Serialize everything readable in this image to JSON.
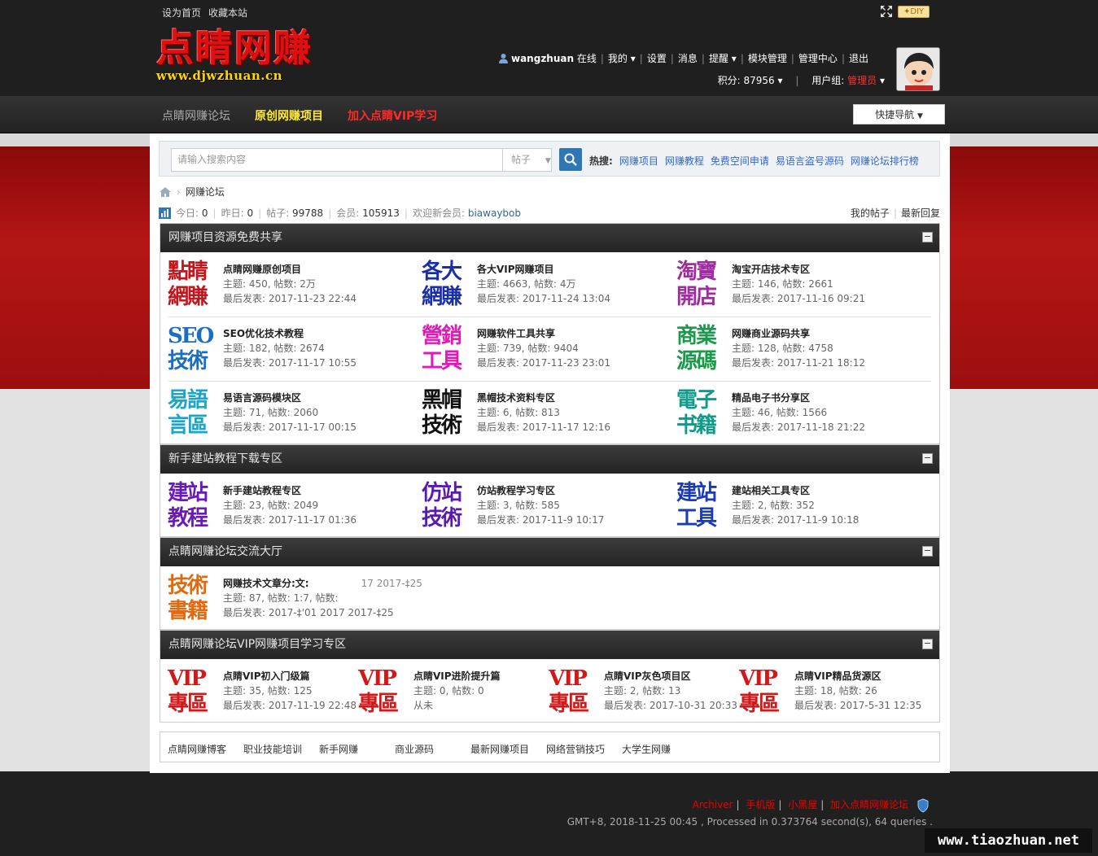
{
  "top": {
    "links": [
      "设为首页",
      "收藏本站"
    ],
    "diy": "DIY"
  },
  "logo": {
    "cn": "点睛网赚",
    "url": "www.djwzhuan.cn"
  },
  "userbar": {
    "username": "wangzhuan",
    "status": "在线",
    "items": [
      "我的",
      "设置",
      "消息",
      "提醒",
      "模块管理",
      "管理中心",
      "退出"
    ],
    "points_label": "积分: 87956",
    "group_label": "用户组:",
    "group": "管理员"
  },
  "nav": {
    "items": [
      "点睛网赚论坛",
      "原创网赚项目",
      "加入点睛VIP学习"
    ],
    "quick": "快捷导航"
  },
  "search": {
    "placeholder": "请输入搜索内容",
    "type": "帖子",
    "hot_label": "热搜:",
    "hot": [
      "网赚项目",
      "网赚教程",
      "免费空间申请",
      "易语言盗号源码",
      "网赚论坛排行榜"
    ]
  },
  "crumb": {
    "title": "网赚论坛"
  },
  "stats": {
    "today_l": "今日:",
    "today": "0",
    "yest_l": "昨日:",
    "yest": "0",
    "posts_l": "帖子:",
    "posts": "99788",
    "members_l": "会员:",
    "members": "105913",
    "welcome": "欢迎新会员:",
    "newuser": "biawaybob",
    "my": "我的帖子",
    "latest": "最新回复"
  },
  "cats": [
    {
      "title": "网赚项目资源免费共享",
      "collapse": "−",
      "forums": [
        {
          "icon": [
            "點睛",
            "網賺"
          ],
          "color": "#c0161c",
          "title": "点睛网赚原创项目",
          "stats": "主题: 450, 帖数: 2万",
          "last": "最后发表: 2017-11-23 22:44"
        },
        {
          "icon": [
            "各大",
            "網賺"
          ],
          "color": "#1a2ea8",
          "title": "各大VIP网赚项目",
          "stats": "主题: 4663, 帖数: 4万",
          "last": "最后发表: 2017-11-24 13:04"
        },
        {
          "icon": [
            "淘寶",
            "開店"
          ],
          "color": "#a02da0",
          "title": "淘宝开店技术专区",
          "stats": "主题: 146, 帖数: 2661",
          "last": "最后发表: 2017-11-16 09:21"
        },
        {
          "icon": [
            "SEO",
            "技術"
          ],
          "color": "#1a6fc2",
          "title": "SEO优化技术教程",
          "stats": "主题: 182, 帖数: 2674",
          "last": "最后发表: 2017-11-17 10:55"
        },
        {
          "icon": [
            "營銷",
            "工具"
          ],
          "color": "#e01ab8",
          "title": "网赚软件工具共享",
          "stats": "主题: 739, 帖数: 9404",
          "last": "最后发表: 2017-11-23 23:01"
        },
        {
          "icon": [
            "商業",
            "源碼"
          ],
          "color": "#1a9a4a",
          "title": "网赚商业源码共享",
          "stats": "主题: 128, 帖数: 4758",
          "last": "最后发表: 2017-11-21 18:12"
        },
        {
          "icon": [
            "易語",
            "言區"
          ],
          "color": "#19a6c8",
          "title": "易语言源码模块区",
          "stats": "主题: 71, 帖数: 2060",
          "last": "最后发表: 2017-11-17 00:15"
        },
        {
          "icon": [
            "黑帽",
            "技術"
          ],
          "color": "#111111",
          "title": "黑帽技术资料专区",
          "stats": "主题: 6, 帖数: 813",
          "last": "最后发表: 2017-11-17 12:16"
        },
        {
          "icon": [
            "電子",
            "书籍"
          ],
          "color": "#0f9a8a",
          "title": "精品电子书分享区",
          "stats": "主题: 46, 帖数: 1566",
          "last": "最后发表: 2017-11-18 21:22"
        }
      ]
    },
    {
      "title": "新手建站教程下载专区",
      "collapse": "−",
      "forums": [
        {
          "icon": [
            "建站",
            "教程"
          ],
          "color": "#6a1ab8",
          "title": "新手建站教程专区",
          "stats": "主题: 23, 帖数: 2049",
          "last": "最后发表: 2017-11-17 01:36"
        },
        {
          "icon": [
            "仿站",
            "技術"
          ],
          "color": "#5a1ab0",
          "title": "仿站教程学习专区",
          "stats": "主题: 3, 帖数: 585",
          "last": "最后发表: 2017-11-9 10:17"
        },
        {
          "icon": [
            "建站",
            "工具"
          ],
          "color": "#1a3ab8",
          "title": "建站相关工具专区",
          "stats": "主题: 2, 帖数: 352",
          "last": "最后发表: 2017-11-9 10:18"
        }
      ]
    },
    {
      "title": "点睛网赚论坛交流大厅",
      "collapse": "−",
      "forums": [
        {
          "icon": [
            "技術",
            "書籍"
          ],
          "color": "#e06a10",
          "title": "网赚技术文章分:文:",
          "extra": "17 2017-‡25",
          "stats": "主题: 87, 帖数: 1:7, 帖数:",
          "last": "最后发表: 2017-‡'01 2017 2017-‡25"
        }
      ]
    },
    {
      "title": "点睛网赚论坛VIP网赚项目学习专区",
      "collapse": "−",
      "forums": [
        {
          "icon": [
            "VIP",
            "專區"
          ],
          "color": "#d01a1a",
          "title": "点睛VIP初入门级篇",
          "stats": "主题: 35, 帖数: 125",
          "last": "最后发表: 2017-11-19 22:48"
        },
        {
          "icon": [
            "VIP",
            "專區"
          ],
          "color": "#d01a1a",
          "title": "点睛VIP进阶提升篇",
          "stats": "主题: 0, 帖数: 0",
          "last": "从未"
        },
        {
          "icon": [
            "VIP",
            "專區"
          ],
          "color": "#d01a1a",
          "title": "点睛VIP灰色项目区",
          "stats": "主题: 2, 帖数: 13",
          "last": "最后发表: 2017-10-31 20:33"
        },
        {
          "icon": [
            "VIP",
            "專區"
          ],
          "color": "#d01a1a",
          "title": "点睛VIP精品货源区",
          "stats": "主题: 18, 帖数: 26",
          "last": "最后发表: 2017-5-31 12:35"
        }
      ]
    }
  ],
  "links": [
    "点睛网赚博客",
    "职业技能培训",
    "新手网赚",
    "商业源码",
    "最新网赚项目",
    "网络营销技巧",
    "大学生网赚"
  ],
  "footer": {
    "items": [
      "Archiver",
      "手机版",
      "小黑屋",
      "加入点睛网赚论坛"
    ],
    "line2": "GMT+8, 2018-11-25 00:45 , Processed in 0.373764 second(s), 64 queries ."
  },
  "watermark": "www.tiaozhuan.net"
}
